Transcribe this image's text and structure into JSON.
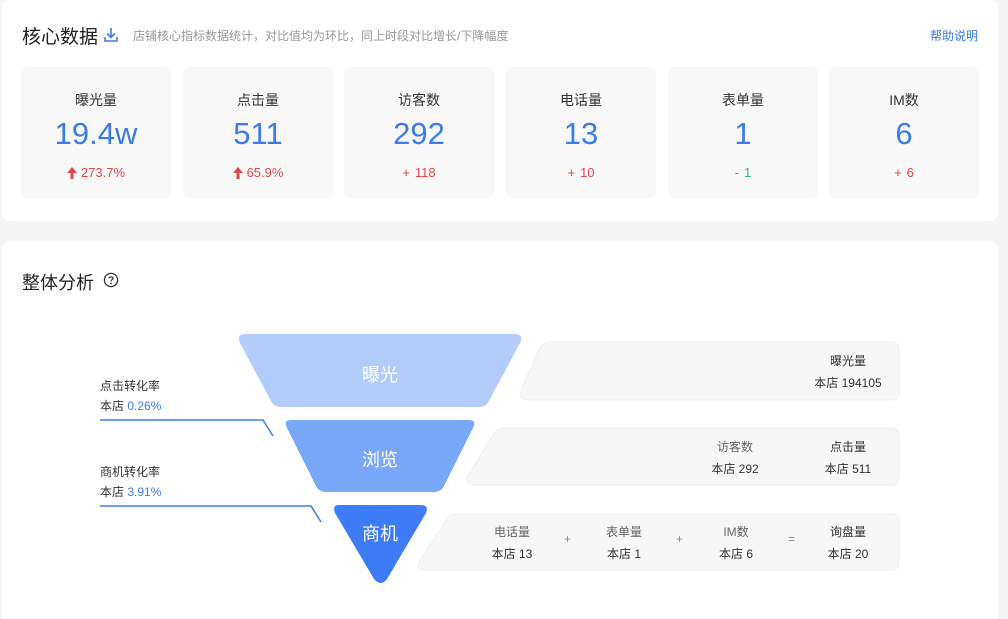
{
  "core": {
    "title": "核心数据",
    "description": "店铺核心指标数据统计，对比值均为环比，同上时段对比增长/下降幅度",
    "help_label": "帮助说明",
    "cards": [
      {
        "label": "曝光量",
        "value": "19.4w",
        "change": "273.7%",
        "trend": "up"
      },
      {
        "label": "点击量",
        "value": "511",
        "change": "65.9%",
        "trend": "up"
      },
      {
        "label": "访客数",
        "value": "292",
        "change": "118",
        "sign": "+",
        "trend": "up"
      },
      {
        "label": "电话量",
        "value": "13",
        "change": "10",
        "sign": "+",
        "trend": "up"
      },
      {
        "label": "表单量",
        "value": "1",
        "change": "1",
        "sign": "-",
        "trend": "down"
      },
      {
        "label": "IM数",
        "value": "6",
        "change": "6",
        "sign": "+",
        "trend": "up"
      }
    ]
  },
  "analysis": {
    "title": "整体分析",
    "funnel": [
      {
        "label": "曝光",
        "color": "#b3cdfb"
      },
      {
        "label": "浏览",
        "color": "#7aa8f8"
      },
      {
        "label": "商机",
        "color": "#3d7bf7"
      }
    ],
    "conversions": [
      {
        "label": "点击转化率",
        "prefix": "本店",
        "value": "0.26%"
      },
      {
        "label": "商机转化率",
        "prefix": "本店",
        "value": "3.91%"
      }
    ],
    "row1": [
      {
        "label": "曝光量",
        "value": "本店 194105"
      }
    ],
    "row2": [
      {
        "label": "访客数",
        "value": "本店 292"
      },
      {
        "label": "点击量",
        "value": "本店 511"
      }
    ],
    "row3": [
      {
        "label": "电话量",
        "value": "本店 13"
      },
      {
        "label": "表单量",
        "value": "本店 1"
      },
      {
        "label": "IM数",
        "value": "本店 6"
      },
      {
        "label": "询盘量",
        "value": "本店 20"
      }
    ],
    "operators": [
      "+",
      "+",
      "="
    ]
  }
}
